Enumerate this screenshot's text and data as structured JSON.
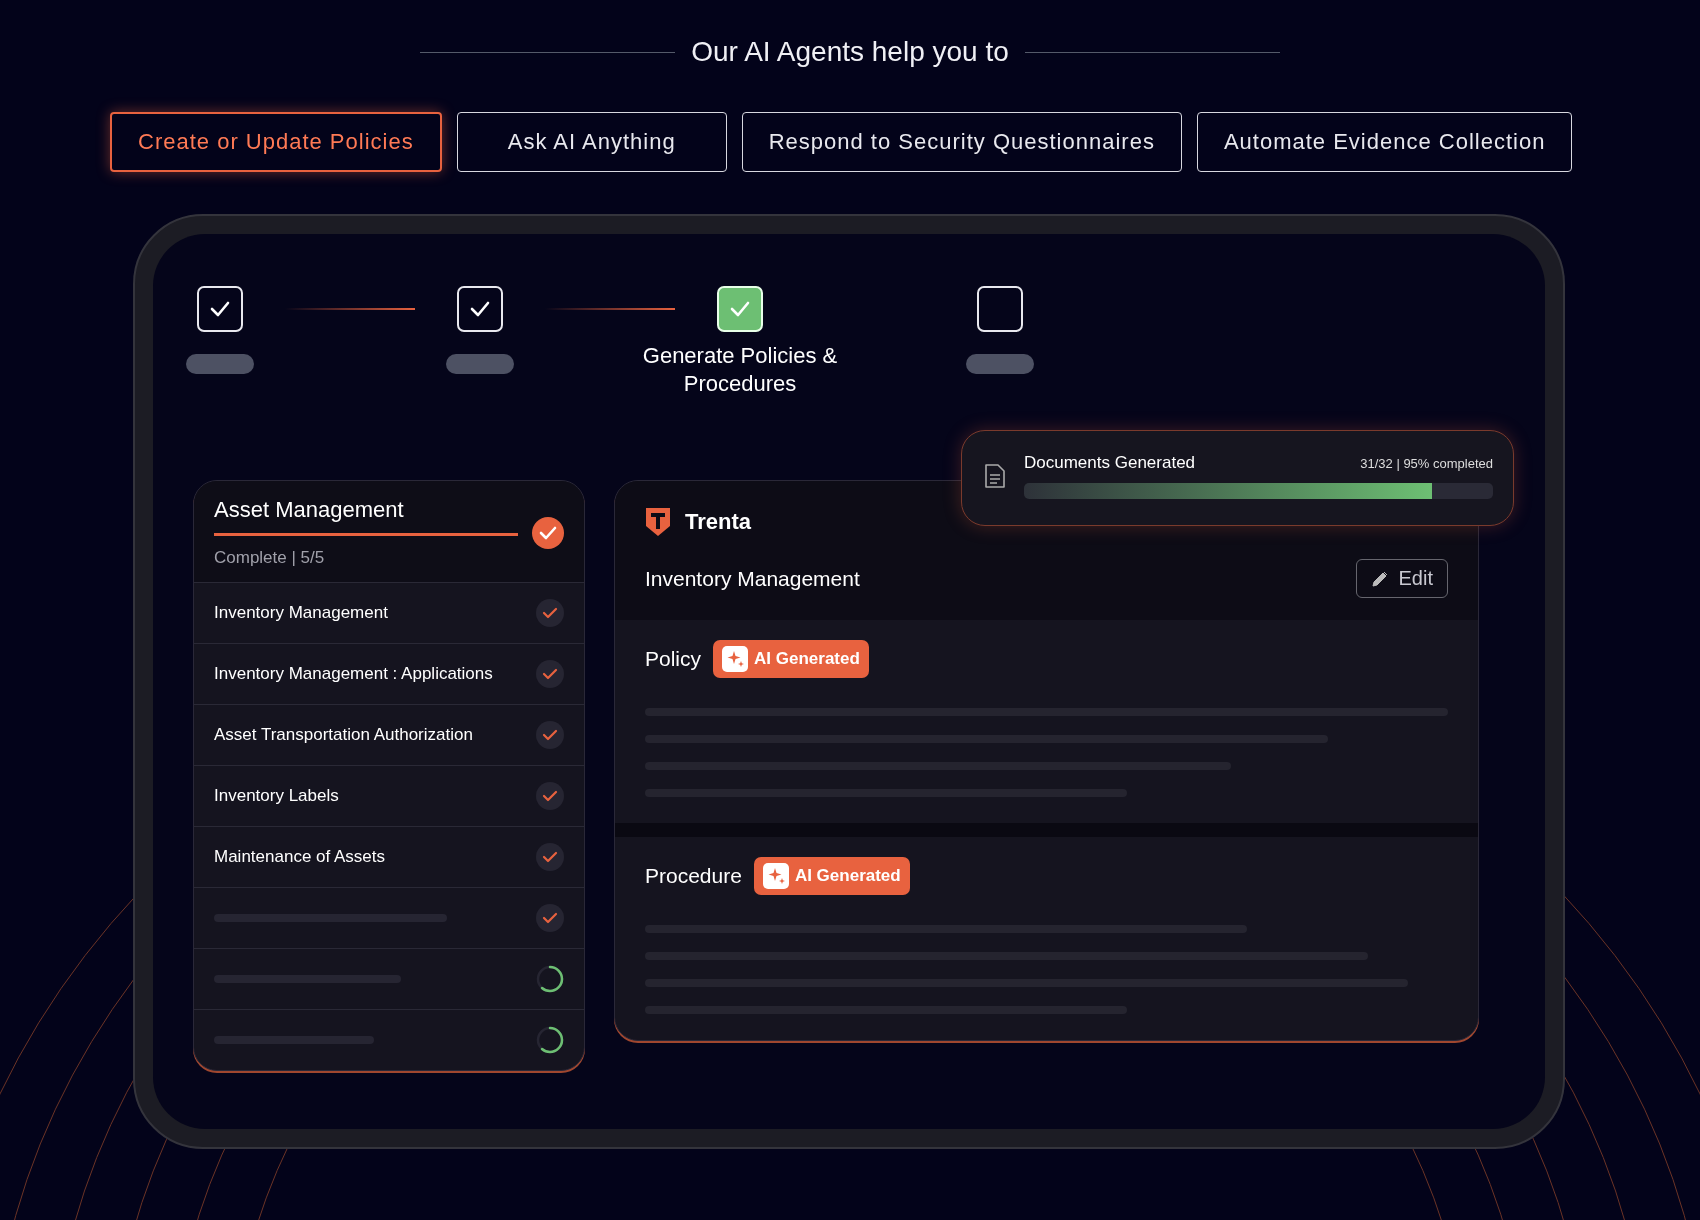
{
  "heading": "Our AI Agents help you to",
  "tabs": [
    {
      "label": "Create or Update Policies",
      "selected": true
    },
    {
      "label": "Ask AI Anything",
      "selected": false
    },
    {
      "label": "Respond to Security Questionnaires",
      "selected": false
    },
    {
      "label": "Automate Evidence Collection",
      "selected": false
    }
  ],
  "steps": [
    {
      "checked": true,
      "selected": false
    },
    {
      "checked": true,
      "selected": false
    },
    {
      "checked": true,
      "selected": true,
      "label": "Generate Policies & Procedures"
    },
    {
      "checked": false,
      "selected": false
    }
  ],
  "checklist": {
    "title": "Asset Management",
    "status": "Complete | 5/5",
    "done": true,
    "items": [
      {
        "kind": "item",
        "label": "Inventory Management",
        "done": true
      },
      {
        "kind": "item",
        "label": "Inventory Management : Applications",
        "done": true
      },
      {
        "kind": "item",
        "label": "Asset Transportation Authorization",
        "done": true
      },
      {
        "kind": "item",
        "label": "Inventory Labels",
        "done": true
      },
      {
        "kind": "item",
        "label": "Maintenance of Assets",
        "done": true
      },
      {
        "kind": "placeholder",
        "done": true
      },
      {
        "kind": "placeholder",
        "done": false
      },
      {
        "kind": "placeholder",
        "done": false
      }
    ]
  },
  "documents": {
    "title": "Documents Generated",
    "progress_text": "31/32 | 95% completed",
    "level": 0.87
  },
  "editor": {
    "brand": "Trenta",
    "doc_title": "Inventory Management",
    "edit_label": "Edit",
    "sections": [
      {
        "title": "Policy",
        "badge": "AI Generated"
      },
      {
        "title": "Procedure",
        "badge": "AI Generated"
      }
    ]
  }
}
